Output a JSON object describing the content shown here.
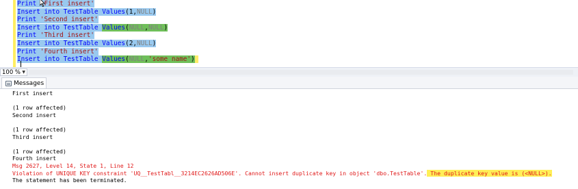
{
  "editor": {
    "lines": [
      {
        "pre": "",
        "kw1": "Print ",
        "str": "'First insert'",
        "rest": ""
      },
      {
        "ins": "Insert into TestTable ",
        "vals": "Values",
        "args": "(1,NULL)",
        "mode": "sel"
      },
      {
        "pre": "",
        "kw1": "Print ",
        "str": "'Second insert'",
        "rest": ""
      },
      {
        "ins": "Insert into TestTable ",
        "vals": "Values",
        "args": "(NULL,NULL)",
        "mode": "grn"
      },
      {
        "pre": "",
        "kw1": "Print ",
        "str": "'Third insert'",
        "rest": ""
      },
      {
        "ins": "Insert into TestTable ",
        "vals": "Values",
        "args": "(2,NULL)",
        "mode": "sel"
      },
      {
        "pre": "",
        "kw1": "Print ",
        "str": "'Fourth insert'",
        "rest": ""
      },
      {
        "ins": "Insert into TestTable ",
        "vals": "Values",
        "args": "(NULL,'some name')",
        "mode": "grn"
      }
    ]
  },
  "zoom": {
    "value": "100 %"
  },
  "tabs": {
    "messages": "Messages"
  },
  "messages": [
    {
      "text": "First insert",
      "type": "normal"
    },
    {
      "text": "",
      "type": "normal"
    },
    {
      "text": "(1 row affected)",
      "type": "normal"
    },
    {
      "text": "Second insert",
      "type": "normal"
    },
    {
      "text": "",
      "type": "normal"
    },
    {
      "text": "(1 row affected)",
      "type": "normal"
    },
    {
      "text": "Third insert",
      "type": "normal"
    },
    {
      "text": "",
      "type": "normal"
    },
    {
      "text": "(1 row affected)",
      "type": "normal"
    },
    {
      "text": "Fourth insert",
      "type": "normal"
    },
    {
      "text": "Msg 2627, Level 14, State 1, Line 12",
      "type": "err"
    },
    {
      "text": "Violation of UNIQUE KEY constraint 'UQ__TestTabl__3214EC2626AD506E'. Cannot insert duplicate key in object 'dbo.TestTable'.",
      "highlight": " The duplicate key value is (<NULL>).",
      "type": "err"
    },
    {
      "text": "The statement has been terminated.",
      "type": "normal"
    }
  ]
}
